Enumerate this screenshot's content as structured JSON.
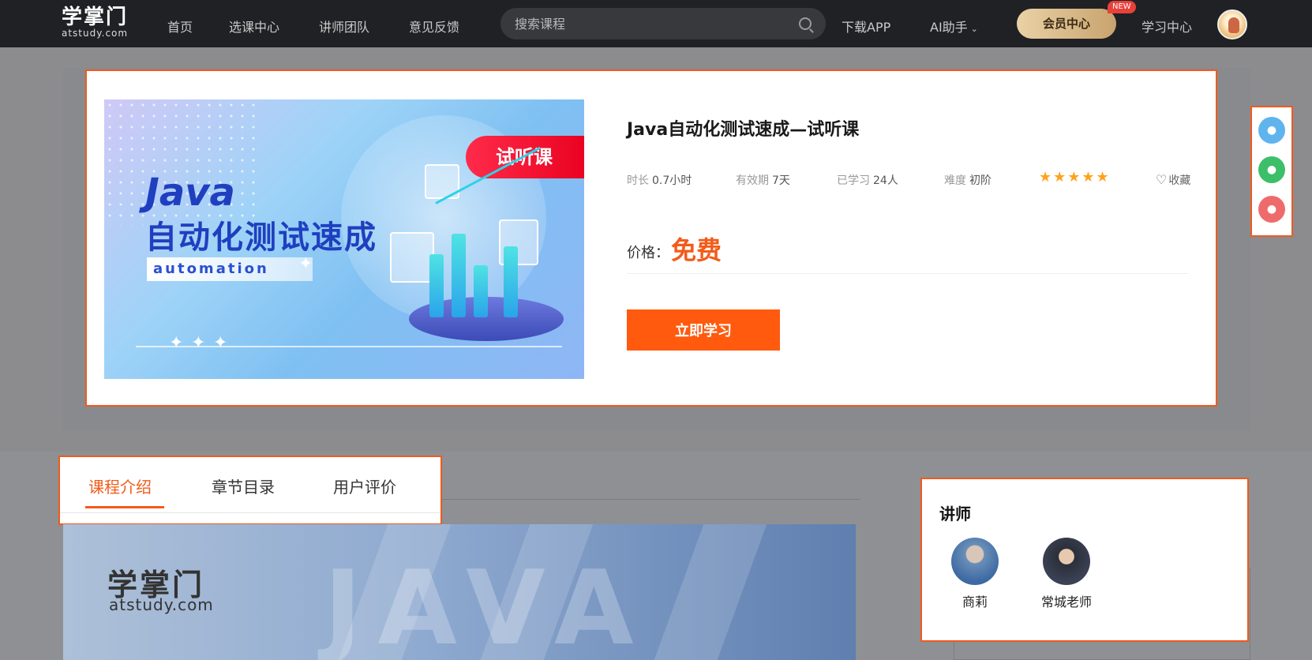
{
  "header": {
    "logo_main": "学掌门",
    "logo_sub": "atstudy.com",
    "nav": [
      "首页",
      "选课中心",
      "讲师团队",
      "意见反馈"
    ],
    "search_placeholder": "搜索课程",
    "download": "下载APP",
    "ai_helper": "AI助手",
    "vip": "会员中心",
    "new_badge": "NEW",
    "study_center": "学习中心"
  },
  "course": {
    "banner": {
      "title_line1": "Java",
      "title_line2": "自动化测试速成",
      "subtitle": "automation",
      "tag": "试听课"
    },
    "title": "Java自动化测试速成—试听课",
    "meta": [
      {
        "label": "时长",
        "value": "0.7小时"
      },
      {
        "label": "有效期",
        "value": "7天"
      },
      {
        "label": "已学习",
        "value": "24人"
      },
      {
        "label": "难度",
        "value": "初阶"
      }
    ],
    "stars": "★★★★★",
    "rating_stars": 5,
    "favorite": "收藏",
    "price_label": "价格：",
    "price_value": "免费",
    "study_button": "立即学习"
  },
  "side_widget": {
    "icons": [
      "qq-icon",
      "wechat-icon",
      "weibo-icon"
    ],
    "colors": [
      "#5fb4ee",
      "#3dbf6a",
      "#ef6b6b"
    ]
  },
  "tabs": {
    "items": [
      "课程介绍",
      "章节目录",
      "用户评价"
    ],
    "active": "课程介绍"
  },
  "intro": {
    "logo_main": "学掌门",
    "logo_sub": "atstudy.com",
    "big_text": "JAVA"
  },
  "teachers": {
    "heading": "讲师",
    "items": [
      {
        "name": "商莉"
      },
      {
        "name": "常城老师"
      }
    ]
  },
  "colors": {
    "accent": "#f25b1a",
    "header_bg": "#202124",
    "star": "#ffa21a",
    "highlight_border": "#f05a1e"
  }
}
